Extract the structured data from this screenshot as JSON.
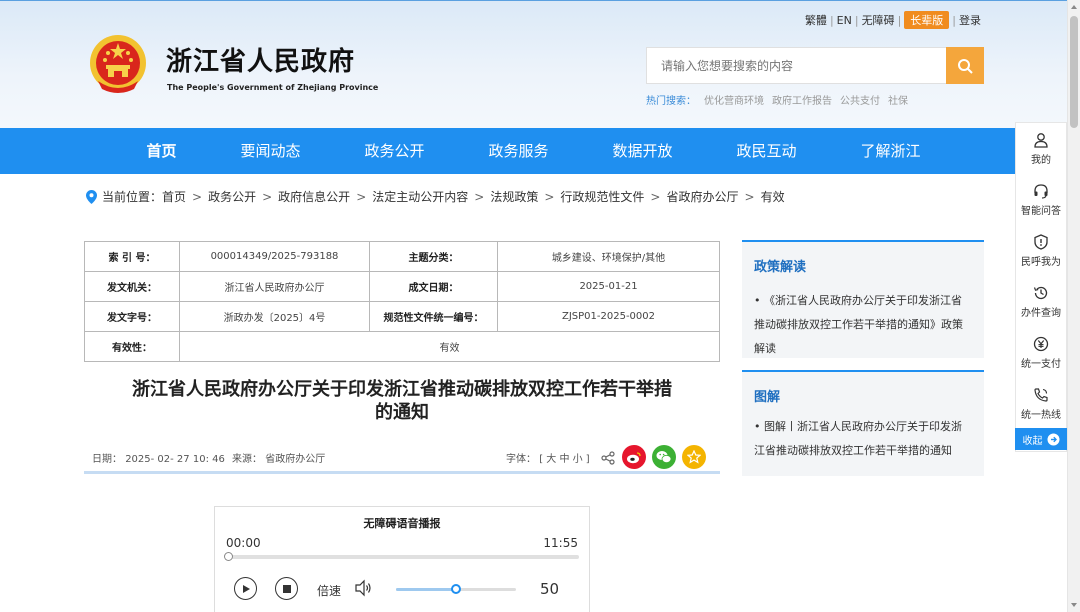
{
  "header": {
    "site_title": "浙江省人民政府",
    "site_subtitle": "The People's Government of Zhejiang Province",
    "toplinks": {
      "traditional": "繁體",
      "english": "EN",
      "accessibility": "无障碍",
      "elder": "长辈版",
      "login": "登录"
    },
    "search": {
      "placeholder": "请输入您想要搜索的内容"
    },
    "hot": {
      "label": "热门搜索：",
      "items": [
        "优化营商环境",
        "政府工作报告",
        "公共支付",
        "社保"
      ]
    }
  },
  "nav": {
    "items": [
      "首页",
      "要闻动态",
      "政务公开",
      "政务服务",
      "数据开放",
      "政民互动",
      "了解浙江"
    ]
  },
  "breadcrumb": {
    "label": "当前位置：",
    "items": [
      "首页",
      "政务公开",
      "政府信息公开",
      "法定主动公开内容",
      "法规政策",
      "行政规范性文件",
      "省政府办公厅",
      "有效"
    ]
  },
  "meta": {
    "index_key": "索 引 号：",
    "index_val": "000014349/2025-793188",
    "topic_key": "主题分类：",
    "topic_val": "城乡建设、环境保护/其他",
    "issuer_key": "发文机关：",
    "issuer_val": "浙江省人民政府办公厅",
    "date_key": "成文日期：",
    "date_val": "2025-01-21",
    "docno_key": "发文字号：",
    "docno_val": "浙政办发〔2025〕4号",
    "code_key": "规范性文件统一编号：",
    "code_val": "ZJSP01-2025-0002",
    "valid_key": "有效性：",
    "valid_val": "有效"
  },
  "document": {
    "title_line1": "浙江省人民政府办公厅关于印发浙江省推动碳排放双控工作若干举措",
    "title_line2": "的通知",
    "date_label": "日期：",
    "date": "2025- 02- 27 10: 46",
    "source_label": "来源：",
    "source": "省政府办公厅",
    "font_label": "字体：",
    "font_options": "[ 大 中 小 ]"
  },
  "player": {
    "title": "无障碍语音播报",
    "current_time": "00:00",
    "total_time": "11:55",
    "progress": 0,
    "speed_label": "倍速",
    "volume": 50
  },
  "sidebar": {
    "policy_heading": "政策解读",
    "policy_item": "《浙江省人民政府办公厅关于印发浙江省推动碳排放双控工作若干举措的通知》政策解读",
    "graphic_heading": "图解",
    "graphic_item": "图解丨浙江省人民政府办公厅关于印发浙江省推动碳排放双控工作若干举措的通知"
  },
  "floatbar": {
    "items": [
      "我的",
      "智能问答",
      "民呼我为",
      "办件查询",
      "统一支付",
      "统一热线"
    ],
    "collapse": "收起"
  },
  "colors": {
    "nav_blue": "#1f8ff0",
    "search_orange": "#f4a63c",
    "elder_orange": "#f08c1f",
    "weibo_red": "#e6162d",
    "wechat_green": "#3cb034",
    "favorite_yellow": "#f4b400"
  }
}
